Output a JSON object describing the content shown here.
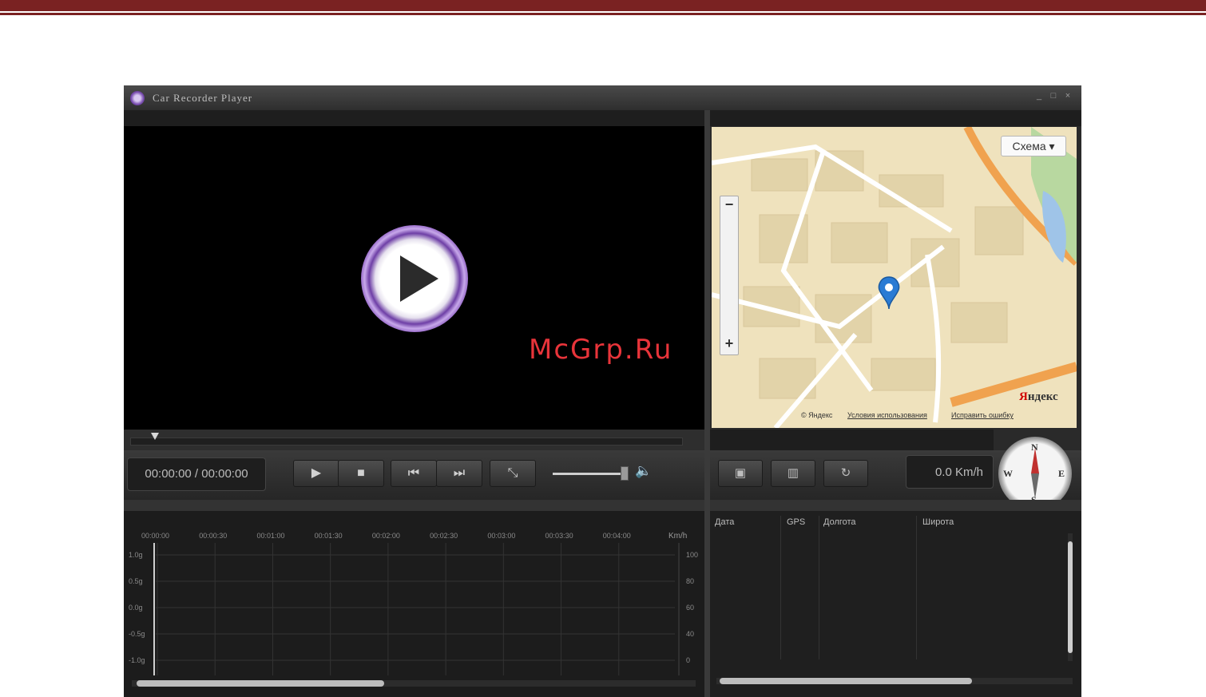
{
  "app": {
    "title": "Car Recorder Player"
  },
  "window": {
    "minimize": "_",
    "maximize": "□",
    "close": "×"
  },
  "player": {
    "time": "00:00:00 / 00:00:00",
    "buttons": {
      "play": "▶",
      "stop": "■",
      "prev": "⏮",
      "next": "⏭",
      "fullscreen": "⤡"
    },
    "volume_icon": "🔈"
  },
  "map": {
    "scheme_button": "Схема ▾",
    "zoom_minus": "−",
    "zoom_plus": "+",
    "brand_red": "Я",
    "brand_rest": "ндекс",
    "footer_left": "© Яндекс",
    "footer_mid": "Условия использования",
    "footer_right": "Исправить ошибку"
  },
  "right_controls": {
    "speed": "0.0 Km/h",
    "btn1_icon": "camera-icon",
    "btn2_icon": "trash-icon",
    "btn3_icon": "refresh-icon"
  },
  "compass": {
    "n": "N",
    "s": "S",
    "e": "E",
    "w": "W"
  },
  "chart": {
    "time_ticks": [
      "00:00:00",
      "00:00:30",
      "00:01:00",
      "00:01:30",
      "00:02:00",
      "00:02:30",
      "00:03:00",
      "00:03:30",
      "00:04:00"
    ],
    "unit_label": "Km/h",
    "left_ticks": [
      "1.0g",
      "0.5g",
      "0.0g",
      "-0.5g",
      "-1.0g"
    ],
    "right_ticks": [
      "100",
      "80",
      "60",
      "40",
      "0"
    ]
  },
  "table": {
    "headers": [
      "Дата",
      "GPS",
      "Долгота",
      "Широта"
    ]
  },
  "watermark": "McGrp.Ru"
}
